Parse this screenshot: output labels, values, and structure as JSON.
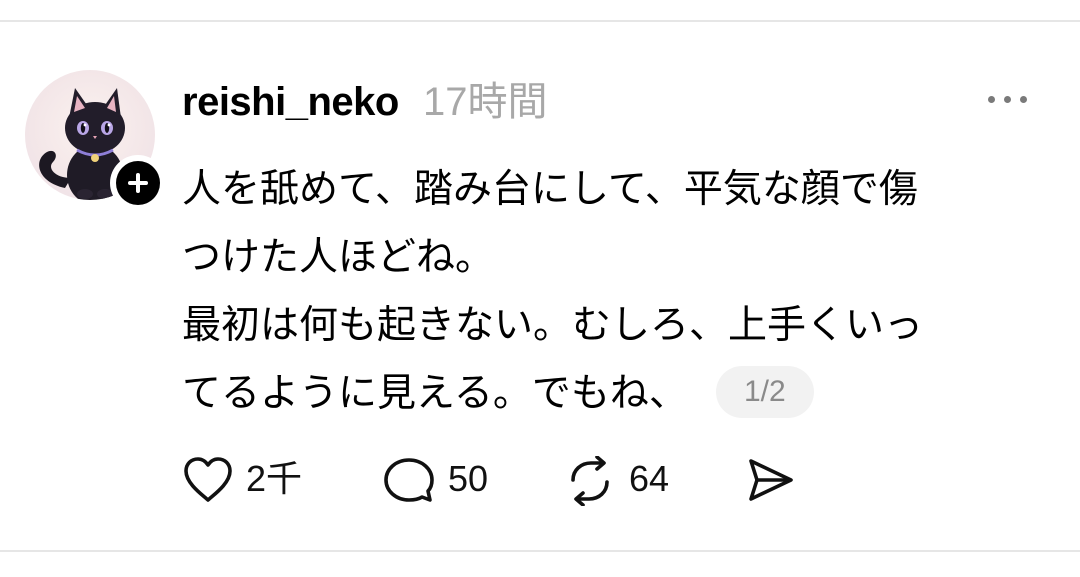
{
  "post": {
    "username": "reishi_neko",
    "timestamp": "17時間",
    "text_lines": [
      "人を舐めて、踏み台にして、平気な顔で傷",
      "つけた人ほどね。",
      "最初は何も起きない。むしろ、上手くいっ",
      "てるように見える。でもね、"
    ],
    "page_indicator": "1/2",
    "avatar_icon": "black-cat-avatar",
    "follow_icon": "plus-icon",
    "more_icon": "ellipsis-icon"
  },
  "actions": {
    "like": {
      "icon": "heart-icon",
      "count": "2千"
    },
    "reply": {
      "icon": "speech-bubble-icon",
      "count": "50"
    },
    "repost": {
      "icon": "repost-icon",
      "count": "64"
    },
    "share": {
      "icon": "send-icon"
    }
  },
  "colors": {
    "text": "#000000",
    "muted": "#a8a8a8",
    "badge_bg": "#f2f2f2",
    "divider": "#e6e6e6"
  }
}
